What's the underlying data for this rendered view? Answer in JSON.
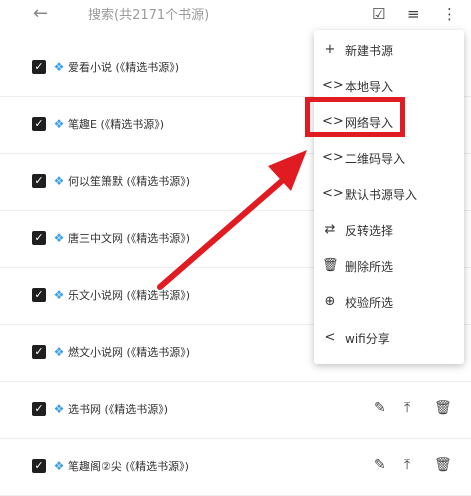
{
  "toolbar": {
    "search_placeholder": "搜索(共2171个书源)"
  },
  "sources": [
    {
      "label": "爱看小说 (《精选书源》)"
    },
    {
      "label": "笔趣E (《精选书源》)"
    },
    {
      "label": "何以笙箫默 (《精选书源》)"
    },
    {
      "label": "唐三中文网 (《精选书源》)"
    },
    {
      "label": "乐文小说网 (《精选书源》)"
    },
    {
      "label": "燃文小说网 (《精选书源》)"
    },
    {
      "label": "选书网 (《精选书源》)"
    },
    {
      "label": "笔趣阁②尖 (《精选书源》)"
    }
  ],
  "menu": [
    {
      "label": "新建书源",
      "icon": "plus-icon"
    },
    {
      "label": "本地导入",
      "icon": "code-icon"
    },
    {
      "label": "网络导入",
      "icon": "code-icon"
    },
    {
      "label": "二维码导入",
      "icon": "code-icon"
    },
    {
      "label": "默认书源导入",
      "icon": "code-icon"
    },
    {
      "label": "反转选择",
      "icon": "swap-icon"
    },
    {
      "label": "删除所选",
      "icon": "trash-icon"
    },
    {
      "label": "校验所选",
      "icon": "check-circle-icon"
    },
    {
      "label": "wifi分享",
      "icon": "share-icon"
    }
  ],
  "colors": {
    "annotation": "#e01c22",
    "source_icon": "#3aa0e8"
  }
}
